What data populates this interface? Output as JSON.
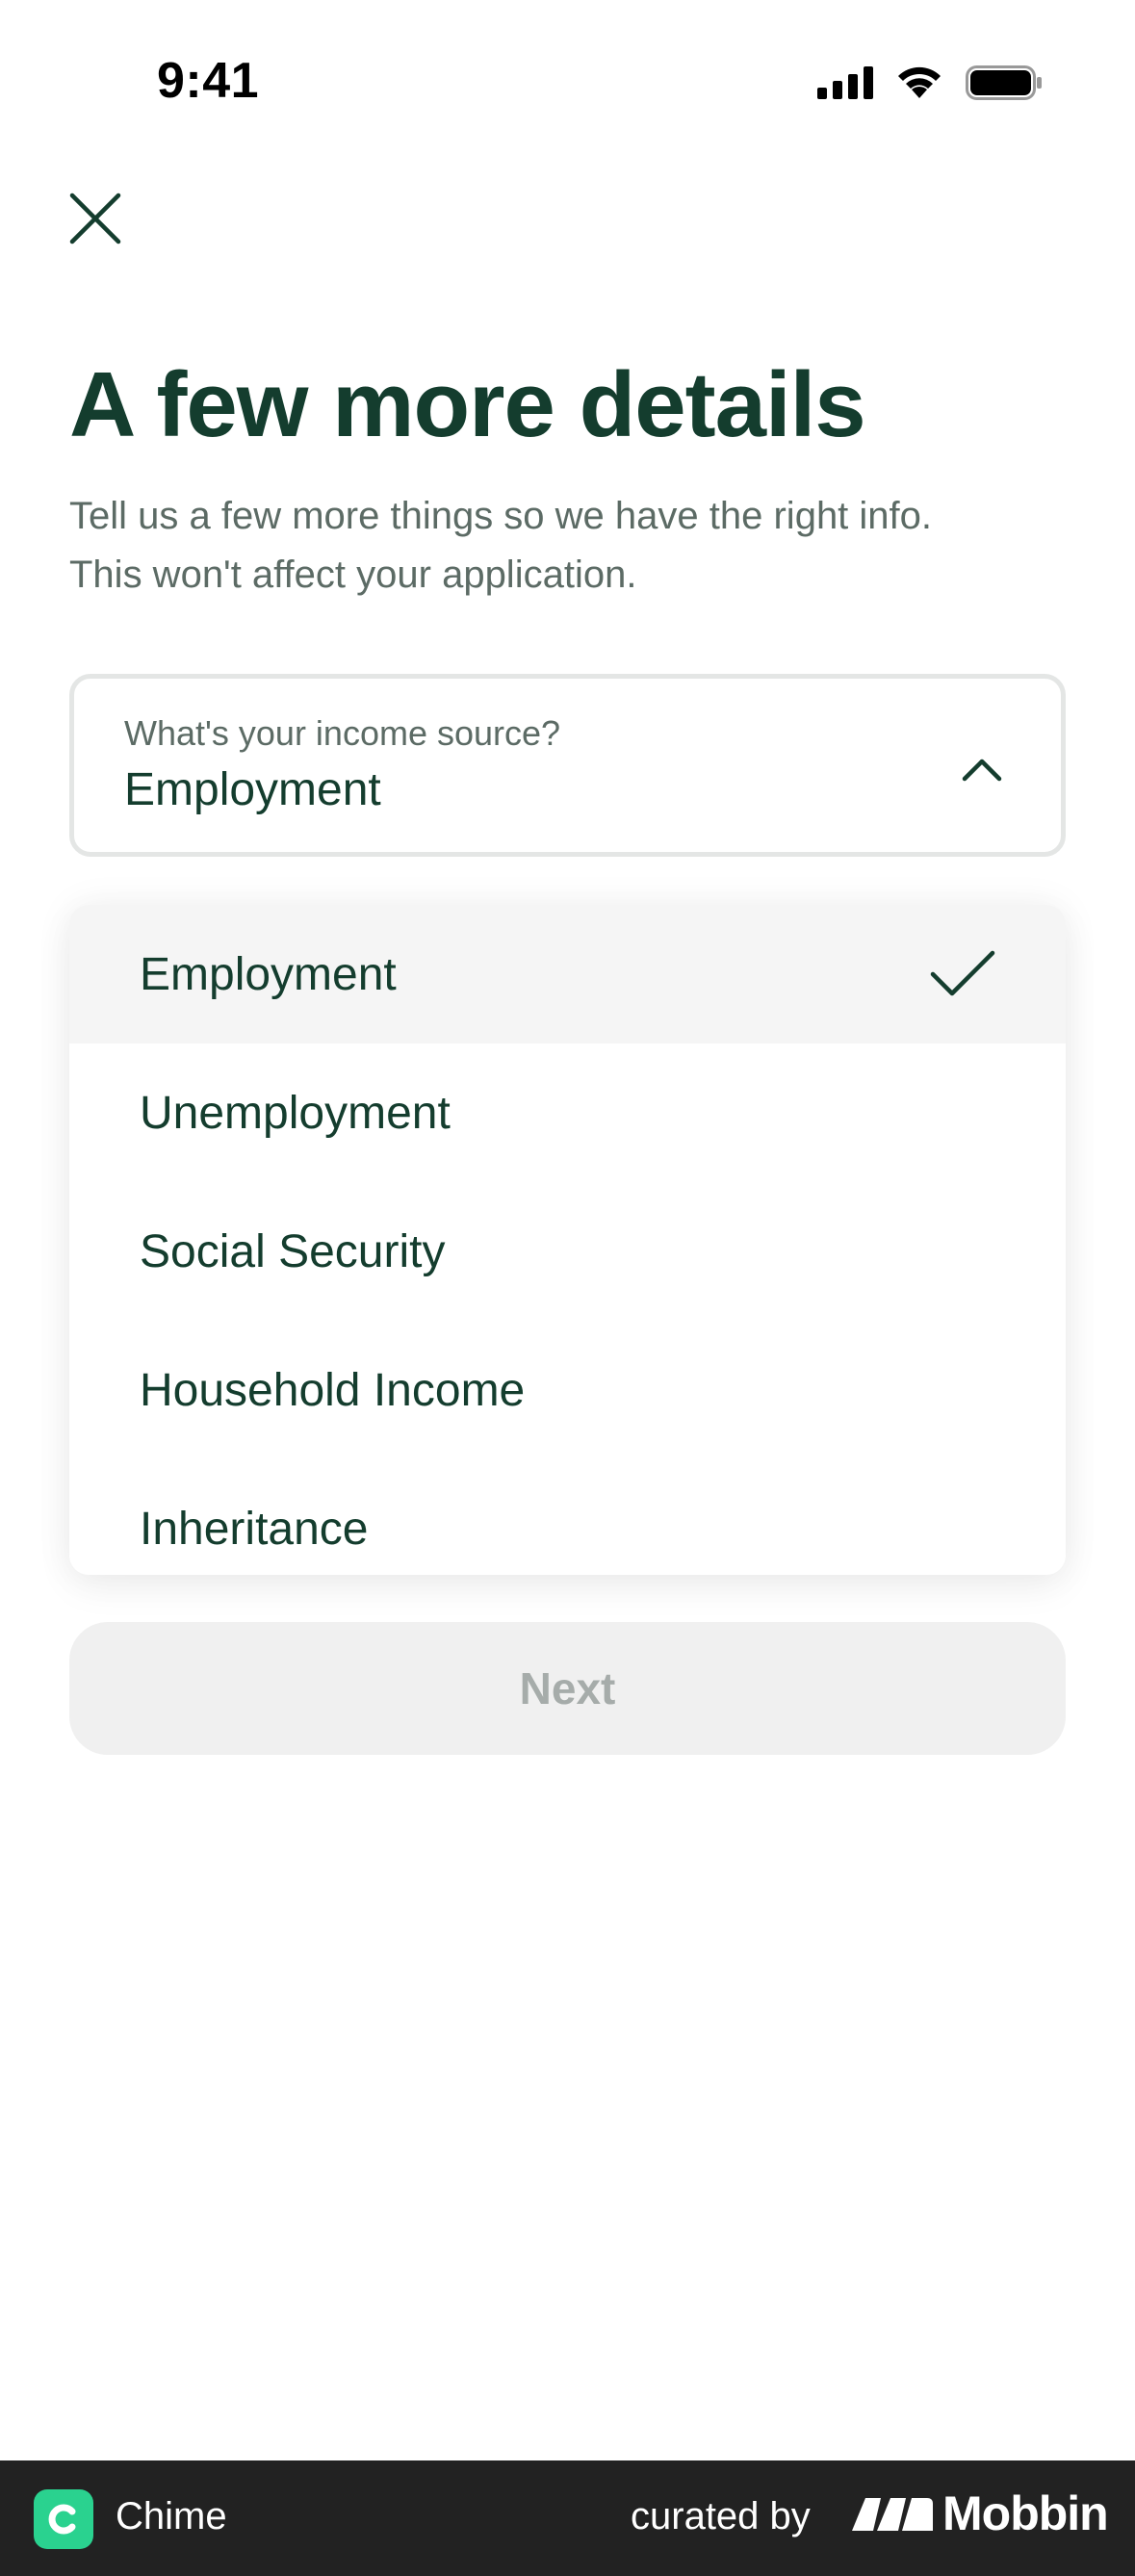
{
  "status_bar": {
    "time": "9:41"
  },
  "header": {
    "close_icon": "close-icon"
  },
  "main": {
    "title": "A few more details",
    "subtitle_line1": "Tell us a few more things so we have the right info.",
    "subtitle_line2": "This won't affect your application."
  },
  "income_select": {
    "label": "What's your income source?",
    "value": "Employment",
    "expanded": true
  },
  "dropdown": {
    "options": [
      {
        "label": "Employment",
        "selected": true
      },
      {
        "label": "Unemployment",
        "selected": false
      },
      {
        "label": "Social Security",
        "selected": false
      },
      {
        "label": "Household Income",
        "selected": false
      },
      {
        "label": "Inheritance",
        "selected": false
      }
    ]
  },
  "actions": {
    "next_label": "Next",
    "next_enabled": false
  },
  "footer": {
    "app_name": "Chime",
    "curated_by": "curated by",
    "brand": "Mobbin"
  },
  "colors": {
    "primary_text": "#143d2e",
    "secondary_text": "#5c6b65",
    "disabled_button_bg": "#f0f0f0",
    "disabled_button_text": "#a6acaa",
    "chime_green": "#2ad28f",
    "footer_bg": "#222222"
  }
}
